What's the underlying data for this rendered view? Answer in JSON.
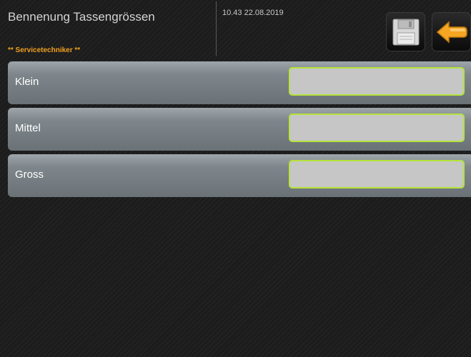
{
  "header": {
    "title": "Bennenung Tassengrössen",
    "subtitle": "** Servicetechniker **",
    "datetime": "10.43 22.08.2019"
  },
  "toolbar": {
    "save_icon": "floppy-disk-icon",
    "back_icon": "back-arrow-icon",
    "accent_color": "#f0a020"
  },
  "rows": [
    {
      "label": "Klein",
      "value": ""
    },
    {
      "label": "Mittel",
      "value": ""
    },
    {
      "label": "Gross",
      "value": ""
    }
  ],
  "colors": {
    "field_border": "#b6e33a",
    "field_fill": "#c6c6c6"
  }
}
